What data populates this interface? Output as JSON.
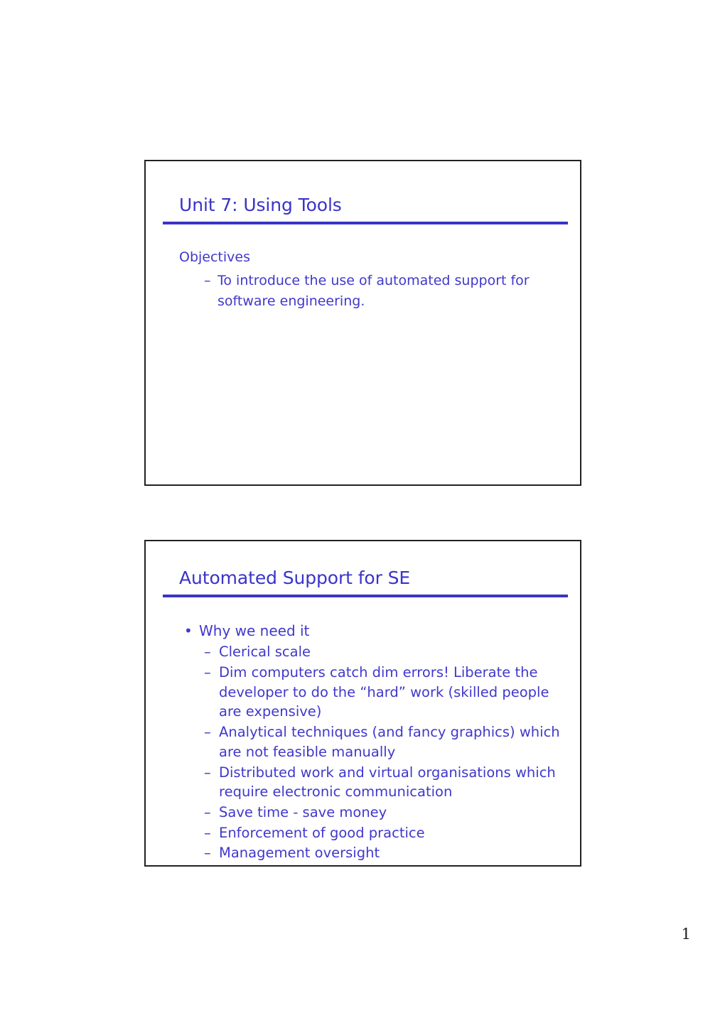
{
  "document": {
    "kind": "presentation-handout",
    "page_number": "1",
    "accent_color": "#3a33c9",
    "body_color": "#4038cb",
    "border_color": "#222222",
    "background_color": "#ffffff"
  },
  "slides": [
    {
      "title": "Unit 7: Using Tools",
      "body": [
        {
          "level": "plain",
          "marker": "",
          "text": "Objectives"
        },
        {
          "level": "dash",
          "marker": "–",
          "text": "To introduce the use of automated support for software engineering."
        }
      ]
    },
    {
      "title": "Automated Support for SE",
      "body": [
        {
          "level": "bullet",
          "marker": "•",
          "text": "Why we need it"
        },
        {
          "level": "dash",
          "marker": "–",
          "text": "Clerical scale"
        },
        {
          "level": "dash",
          "marker": "–",
          "text": "Dim computers catch dim errors! Liberate the developer to do the “hard” work (skilled people are expensive)"
        },
        {
          "level": "dash",
          "marker": "–",
          "text": "Analytical techniques (and fancy graphics) which are not feasible manually"
        },
        {
          "level": "dash",
          "marker": "–",
          "text": "Distributed work and virtual organisations which require electronic communication"
        },
        {
          "level": "dash",
          "marker": "–",
          "text": "Save time - save money"
        },
        {
          "level": "dash",
          "marker": "–",
          "text": "Enforcement of good practice"
        },
        {
          "level": "dash",
          "marker": "–",
          "text": "Management oversight"
        }
      ]
    }
  ]
}
